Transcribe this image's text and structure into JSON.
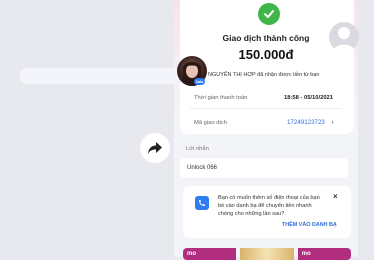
{
  "transaction": {
    "status_title": "Giao dịch thành công",
    "amount": "150.000đ",
    "notify_text": "NGUYỄN THỊ HỢP đã nhận được tiền từ bạn",
    "avatar_badge": "Zalo",
    "time_label": "Thời gian thanh toán",
    "time_value": "18:58 - 05/10/2021",
    "txn_label": "Mã giao dịch",
    "txn_value": "17249123723"
  },
  "message": {
    "label": "Lời nhắn",
    "text": "Unlock 066"
  },
  "contact_prompt": {
    "text": "Bạn có muốn thêm số điện thoại của bạn bè vào danh bạ để chuyển tiền nhanh chóng cho những lần sau?",
    "action_label": "THÊM VÀO DANH BẠ"
  },
  "banner": {
    "tiles": [
      "mo",
      "mo"
    ]
  },
  "colors": {
    "success": "#3fb54a",
    "link": "#2f6fd9",
    "accent": "#2f7bf2",
    "banner": "#b12d7e"
  },
  "icons": [
    "check-icon",
    "profile-placeholder-icon",
    "share-icon",
    "contact-book-icon",
    "close-icon",
    "chevron-right-icon"
  ]
}
